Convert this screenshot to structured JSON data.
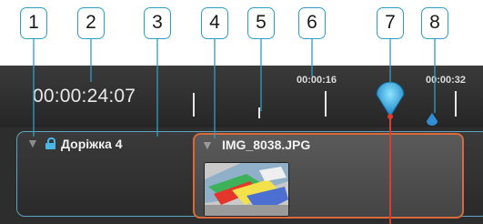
{
  "callouts": [
    "1",
    "2",
    "3",
    "4",
    "5",
    "6",
    "7",
    "8"
  ],
  "timeline": {
    "current_time": "00:00:24:07",
    "ruler_labels": [
      "00:00:16",
      "00:00:32"
    ]
  },
  "track": {
    "name": "Доріжка 4",
    "locked": true
  },
  "clip": {
    "name": "IMG_8038.JPG"
  },
  "colors": {
    "accent_blue": "#2e9fc4",
    "playhead_red": "#e03a2c",
    "clip_border": "#d86a3a"
  }
}
